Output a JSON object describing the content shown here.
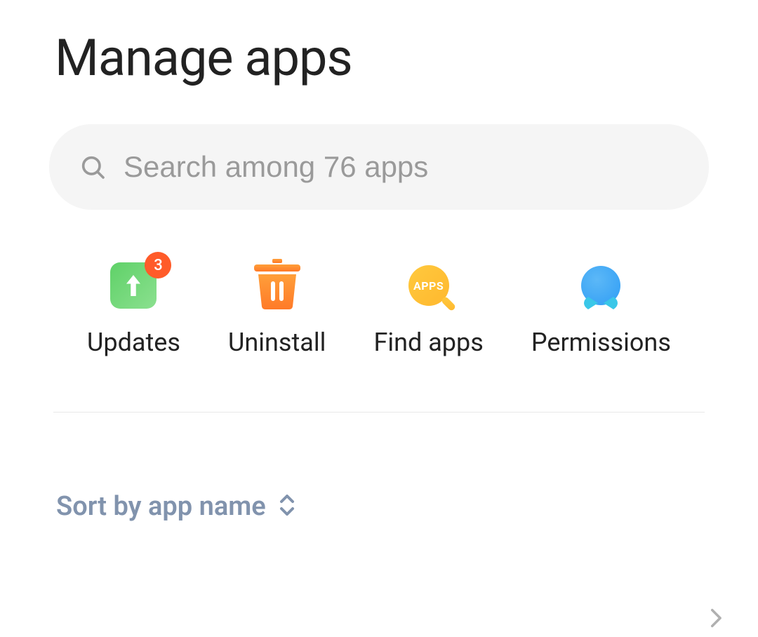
{
  "page": {
    "title": "Manage apps"
  },
  "search": {
    "placeholder": "Search among 76 apps"
  },
  "actions": {
    "updates": {
      "label": "Updates",
      "badge": "3"
    },
    "uninstall": {
      "label": "Uninstall"
    },
    "findapps": {
      "label": "Find apps",
      "icon_text": "APPS"
    },
    "permissions": {
      "label": "Permissions"
    }
  },
  "sort": {
    "label": "Sort by app name"
  }
}
